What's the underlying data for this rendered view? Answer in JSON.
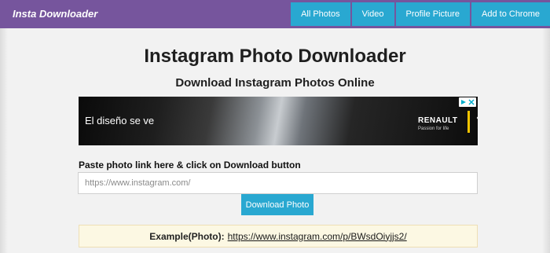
{
  "header": {
    "brand": "Insta Downloader",
    "background": "#76559d",
    "nav": [
      {
        "label": "All Photos"
      },
      {
        "label": "Video"
      },
      {
        "label": "Profile Picture"
      },
      {
        "label": "Add to Chrome"
      }
    ],
    "nav_color": "#29a8d1"
  },
  "main": {
    "title": "Instagram Photo Downloader",
    "subtitle": "Download Instagram Photos Online"
  },
  "ad": {
    "headline": "El diseño se ve",
    "brand": "RENAULT",
    "tagline": "Passion for life",
    "logo_icon": "renault-diamond-icon",
    "badge_icons": [
      "adchoices-icon",
      "close-icon"
    ]
  },
  "form": {
    "label": "Paste photo link here & click on Download button",
    "input_placeholder": "https://www.instagram.com/",
    "button_label": "Download Photo",
    "button_color": "#29a8d1"
  },
  "example": {
    "label": "Example(Photo):",
    "link_text": "https://www.instagram.com/p/BWsdOiyjjs2/",
    "background": "#fcf8e3"
  }
}
